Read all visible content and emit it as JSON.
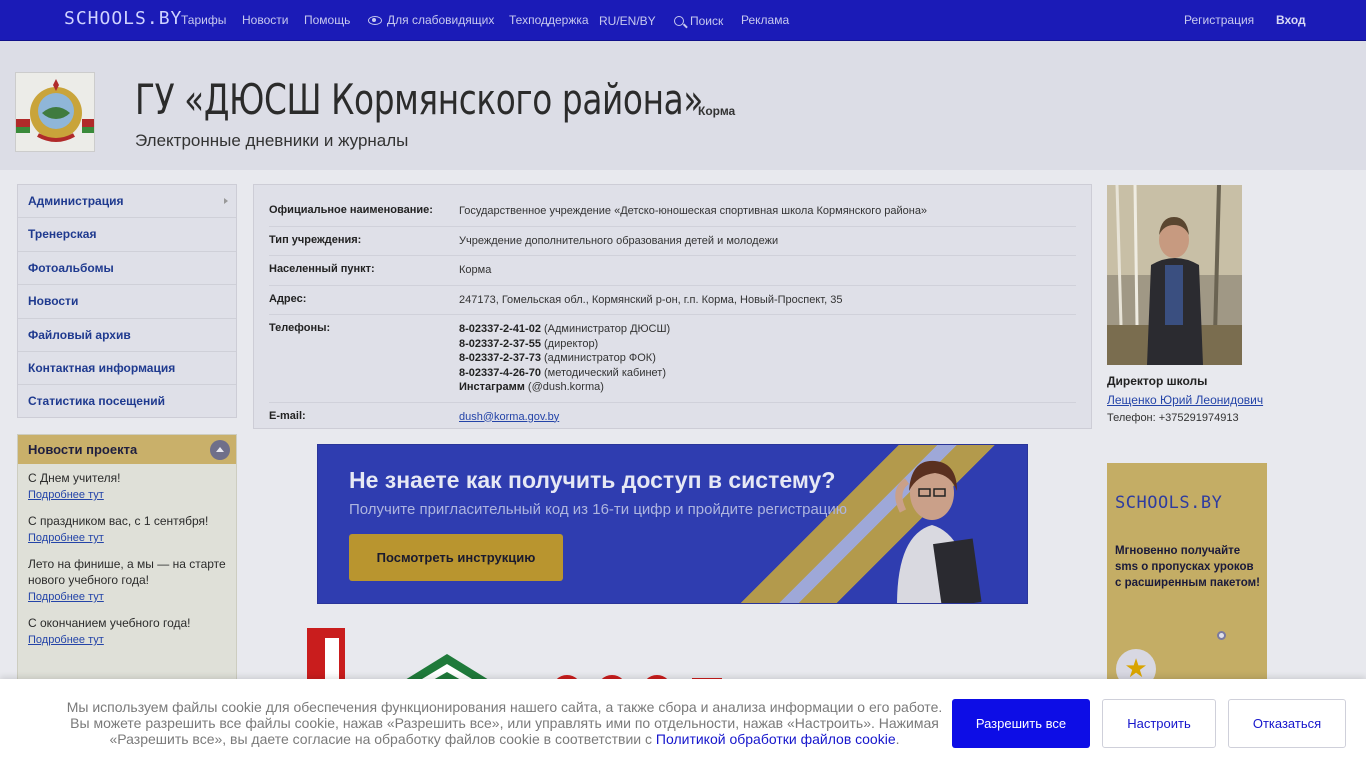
{
  "topnav": {
    "logo": "SCHOOLS.BY",
    "items": [
      "Тарифы",
      "Новости",
      "Помощь",
      "Для слабовидящих",
      "Техподдержка",
      "RU/EN/BY",
      "Поиск",
      "Реклама"
    ],
    "register": "Регистрация",
    "login": "Вход"
  },
  "header": {
    "title": "ГУ «ДЮСШ Кормянского района»",
    "city": "Корма",
    "subtitle": "Электронные дневники и журналы"
  },
  "sidebar": {
    "items": [
      {
        "label": "Администрация"
      },
      {
        "label": "Тренерская"
      },
      {
        "label": "Фотоальбомы"
      },
      {
        "label": "Новости"
      },
      {
        "label": "Файловый архив"
      },
      {
        "label": "Контактная информация"
      },
      {
        "label": "Статистика посещений"
      }
    ]
  },
  "news": {
    "title": "Новости проекта",
    "items": [
      {
        "title": "С Днем учителя!",
        "link": "Подробнее тут"
      },
      {
        "title": "С праздником вас, с 1 сентября!",
        "link": "Подробнее тут"
      },
      {
        "title": "Лето на финише, а мы — на старте нового учебного года!",
        "link": "Подробнее тут"
      },
      {
        "title": "С окончанием учебного года!",
        "link": "Подробнее тут"
      }
    ]
  },
  "info": {
    "official_label": "Официальное наименование:",
    "official_value": "Государственное учреждение «Детско-юношеская спортивная школа Кормянского района»",
    "type_label": "Тип учреждения:",
    "type_value": "Учреждение дополнительного образования детей и молодежи",
    "locality_label": "Населенный пункт:",
    "locality_value": "Корма",
    "address_label": "Адрес:",
    "address_value": "247173, Гомельская обл., Кормянский р-он, г.п. Корма, Новый-Проспект, 35",
    "phones_label": "Телефоны:",
    "phones": [
      {
        "number": "8-02337-2-41-02",
        "note": " (Администратор ДЮСШ)"
      },
      {
        "number": "8-02337-2-37-55",
        "note": " (директор)"
      },
      {
        "number": "8-02337-2-37-73",
        "note": " (администратор ФОК)"
      },
      {
        "number": "8-02337-4-26-70",
        "note": " (методический кабинет)"
      },
      {
        "number": "Инстаграмм",
        "note": " (@dush.korma)"
      }
    ],
    "email_label": "E-mail:",
    "email_value": "dush@korma.gov.by"
  },
  "banner": {
    "title": "Не знаете как получить доступ в систему?",
    "subtitle": "Получите пригласительный код из 16-ти цифр и пройдите регистрацию",
    "button": "Посмотреть инструкцию"
  },
  "director": {
    "role": "Директор школы",
    "name": "Лещенко Юрий Леонидович",
    "phone": "Телефон: +375291974913"
  },
  "promo": {
    "logo": "SCHOOLS.BY",
    "text": "Мгновенно получайте sms о пропусках уроков с расширенным пакетом!"
  },
  "cookie": {
    "text": "Мы используем файлы cookie для обеспечения функционирования нашего сайта, а также сбора и анализа информации о его работе. Вы можете разрешить все файлы cookie, нажав «Разрешить все», или управлять ими по отдельности, нажав «Настроить». Нажимая «Разрешить все», вы даете согласие на обработку файлов cookie в соответствии с ",
    "link": "Политикой обработки файлов cookie",
    "tail": ".",
    "allow": "Разрешить все",
    "settings": "Настроить",
    "decline": "Отказаться"
  }
}
